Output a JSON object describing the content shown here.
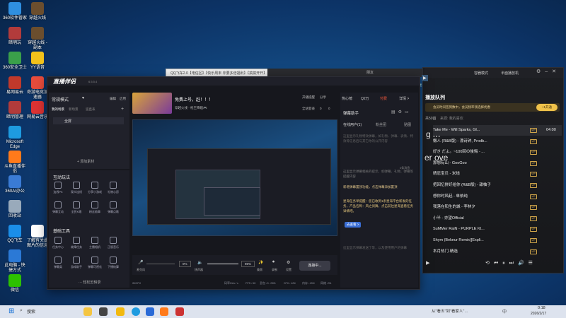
{
  "desktop": {
    "icons": [
      {
        "label": "360软件管家",
        "color": "#2f8fe0"
      },
      {
        "label": "穿越火线",
        "color": "#6b4e2e"
      },
      {
        "label": "暗明玩",
        "color": "#b23b3b"
      },
      {
        "label": "穿越火线 - 副本",
        "color": "#6b4e2e"
      },
      {
        "label": "360安全卫士",
        "color": "#3aa04a"
      },
      {
        "label": "YY语音",
        "color": "#f2c21b"
      },
      {
        "label": "易网易云",
        "color": "#c0392b"
      },
      {
        "label": "奇游电竞加速器",
        "color": "#e74c3c"
      },
      {
        "label": "暗明管理",
        "color": "#b23b3b"
      },
      {
        "label": "网易云音乐",
        "color": "#d33"
      },
      {
        "label": "Microsoft Edge",
        "color": "#1e9be0"
      },
      {
        "label": "斗鱼直播伴侣",
        "color": "#ff7a1a"
      },
      {
        "label": "360AI办公",
        "color": "#3a7bd5"
      },
      {
        "label": "回收站",
        "color": "#9ab"
      },
      {
        "label": "QQ飞车",
        "color": "#1b8ee8"
      },
      {
        "label": "了解有关此图片的信息",
        "color": "#fff"
      },
      {
        "label": "此电脑 - 快捷方式",
        "color": "#2b79d6"
      },
      {
        "label": "微信",
        "color": "#2dc100"
      }
    ]
  },
  "qq_window": {
    "title": "QQ飞车2.0【电信区】【快乐周末 非要多倍福利】【搞搞开开】"
  },
  "lower_window": {
    "title": "朋友"
  },
  "music": {
    "tab": "播放队列",
    "mode": "容器模式",
    "mode2": "半面播放机",
    "banner": "会员时间签到数中，会员频率领选择优惠",
    "banner_btn": "+1开通",
    "count": "共50首",
    "source": "来源: 我的喜欢",
    "lyric_a": "g m",
    "lyric_b": "er ove",
    "tracks": [
      {
        "title": "Take Me - Will Sparks, Gl...",
        "time": "04:00",
        "active": true
      },
      {
        "title": "懒人 (R&B版) - 漂诗钟, Prodb...",
        "time": ""
      },
      {
        "title": "好き だよ。~100回の後悔 - ...",
        "time": ""
      },
      {
        "title": "那想有山 - GooGoo",
        "time": ""
      },
      {
        "title": "晴忍宝贝 - 米线",
        "time": ""
      },
      {
        "title": "把回忆拼好给你 (R&B版) - 甜柚子",
        "time": ""
      },
      {
        "title": "想你时风起 - 单依纯",
        "time": ""
      },
      {
        "title": "我落在阳生的城 - 李林夕",
        "time": ""
      },
      {
        "title": "小半 - 亦望Official",
        "time": ""
      },
      {
        "title": "SuMMer RaiN - PURPLE KI...",
        "time": ""
      },
      {
        "title": "Shym (Beknur Remix)[Expli...",
        "time": ""
      },
      {
        "title": "本月热门·精选",
        "time": ""
      }
    ]
  },
  "zb": {
    "logo": "直播伴侣",
    "version": "6.5.5.4",
    "mode": "常规模式",
    "edit": "编辑",
    "switch": "启用",
    "scene_tabs": [
      "我的场景",
      "新场景",
      "竖直表"
    ],
    "scene_item": "全屏",
    "add_material": "+ 添加素材",
    "interact_title": "互动玩法",
    "interact": [
      "连线PK",
      "观众连线",
      "分享小游戏",
      "礼物心愿",
      "弹幕互动",
      "全民K歌",
      "粉丝勋章",
      "弹幕点歌"
    ],
    "tools_title": "基础工具",
    "tools": [
      "任务中心",
      "故障任务",
      "主播相机",
      "正版音乐",
      "弹幕类",
      "游戏助手",
      "弹幕可视化",
      "下播结算"
    ],
    "tools_more": "··· 轻松剪辑录",
    "stream_title": "免费上号，赶！！！",
    "stream_sub": "穿越火线 · 枪王降临🎮",
    "open_live": "开播提醒",
    "share": "分享",
    "auto": "全站登录",
    "like": "0",
    "msg": "0",
    "rtabs": [
      "热心榜",
      "Q2万",
      "付费",
      "详情 >"
    ],
    "assistant": "弹幕助手",
    "online": "在线用户(1)",
    "fans": "粉丝团",
    "gift": "贴图",
    "notice1": "这里显示礼物特效弹幕，如礼物、弹幕、表情、特效等信息后与其它你的公开内容",
    "notice2": "这里显示弹幕相关的提示，如弹幕、礼物、弹幕等提醒内容",
    "announce_title": "新增弹幕置顶功能，点击弹幕添加置顶",
    "announce_text": "星海任务单提醒：您已收到1条星海平台新发的任务，产品名称：风之剑舞，点击前往星海查看任务详情吧。",
    "announce_btn": "去查看 >",
    "tip_right": "0条消息",
    "bottom_hint": "这里显示弹幕发送了等，以及使用用户的弹幕",
    "ctrl": {
      "mic": "麦克风",
      "mic_val": "0%",
      "spk": "扬声器",
      "spk_val": "96%",
      "beauty": "美颜",
      "rec": "录制",
      "settings": "设置",
      "connecting": "连接中..."
    },
    "status": {
      "stats": "码率0kb/s",
      "fps": "FPS:30",
      "loss": "丢包:0.00%",
      "cpu": "CPU:12%",
      "mem": "内存:15%",
      "net": "网络:0%",
      "cdn": "0%CPU"
    }
  },
  "taskbar": {
    "search": "搜索",
    "notify": "从\"看五\"到\"看家人\"…",
    "time": "0:18",
    "date": "2026/2/17",
    "lang": "中"
  }
}
